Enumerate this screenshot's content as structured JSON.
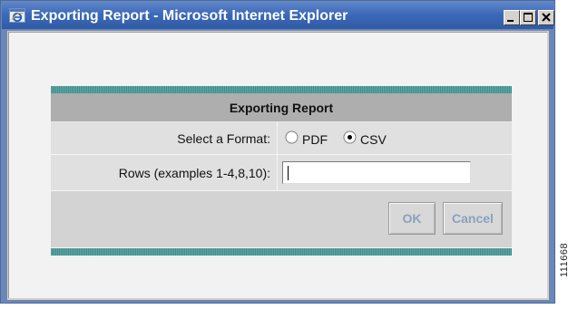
{
  "window": {
    "title": "Exporting Report - Microsoft Internet Explorer",
    "app_icon": "ie-icon",
    "controls": {
      "minimize_icon": "minimize-icon",
      "maximize_icon": "maximize-icon",
      "close_icon": "close-icon"
    }
  },
  "dialog": {
    "header": "Exporting Report",
    "format": {
      "label": "Select a Format:",
      "options": [
        {
          "label": "PDF",
          "selected": false
        },
        {
          "label": "CSV",
          "selected": true
        }
      ]
    },
    "rows": {
      "label": "Rows (examples 1-4,8,10):",
      "value": ""
    },
    "actions": {
      "ok_label": "OK",
      "cancel_label": "Cancel",
      "enabled": false
    }
  },
  "figure_number": "111668",
  "colors": {
    "titlebar": "#3d6ab8",
    "header_bg": "#aeaeae",
    "row_bg": "#e0e0e0",
    "accent_stripe": "#4a9a98",
    "disabled_button_text": "#8da0bd"
  }
}
